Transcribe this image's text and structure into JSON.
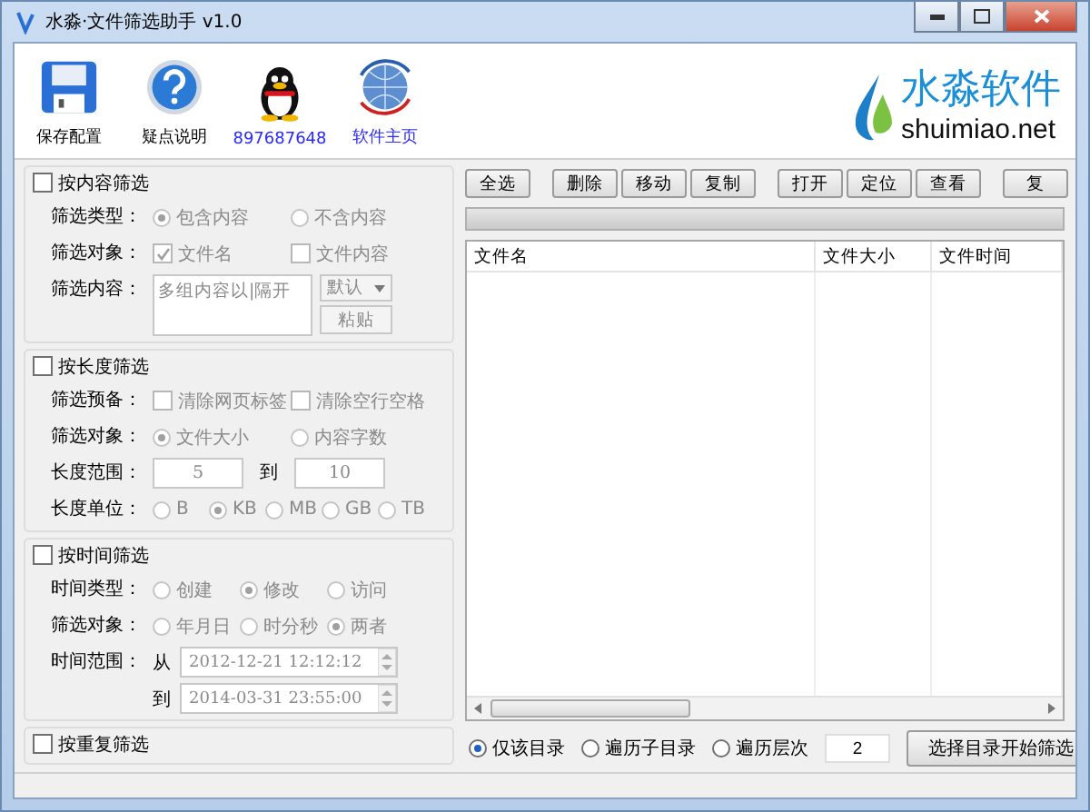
{
  "window": {
    "title": "水淼·文件筛选助手 v1.0"
  },
  "toolbar": [
    {
      "label": "保存配置",
      "kind": "save",
      "link": false
    },
    {
      "label": "疑点说明",
      "kind": "help",
      "link": false
    },
    {
      "label": "897687648",
      "kind": "penguin",
      "link": true
    },
    {
      "label": "软件主页",
      "kind": "globe",
      "link": true
    }
  ],
  "logo": {
    "name": "水淼软件",
    "domain": "shuimiao.net"
  },
  "sections": [
    {
      "title": "按内容筛选",
      "checked": false,
      "rows": [
        {
          "label": "筛选类型：",
          "kind": "radio",
          "options": [
            {
              "label": "包含内容",
              "selected": true
            },
            {
              "label": "不含内容",
              "selected": false
            }
          ]
        },
        {
          "label": "筛选对象：",
          "kind": "checkbox",
          "options": [
            {
              "label": "文件名",
              "checked": true
            },
            {
              "label": "文件内容",
              "checked": false
            }
          ]
        },
        {
          "label": "筛选内容：",
          "kind": "textarea",
          "placeholder": "多组内容以|隔开",
          "dropdown": "默认",
          "button": "粘贴"
        }
      ]
    },
    {
      "title": "按长度筛选",
      "checked": false,
      "rows": [
        {
          "label": "筛选预备：",
          "kind": "checkbox",
          "options": [
            {
              "label": "清除网页标签",
              "checked": false
            },
            {
              "label": "清除空行空格",
              "checked": false
            }
          ]
        },
        {
          "label": "筛选对象：",
          "kind": "radio",
          "options": [
            {
              "label": "文件大小",
              "selected": true
            },
            {
              "label": "内容字数",
              "selected": false
            }
          ]
        },
        {
          "label": "长度范围：",
          "kind": "range",
          "from": "5",
          "separator": "到",
          "to": "10"
        },
        {
          "label": "长度单位：",
          "kind": "radio",
          "options": [
            {
              "label": "B",
              "selected": false
            },
            {
              "label": "KB",
              "selected": true
            },
            {
              "label": "MB",
              "selected": false
            },
            {
              "label": "GB",
              "selected": false
            },
            {
              "label": "TB",
              "selected": false
            }
          ]
        }
      ]
    },
    {
      "title": "按时间筛选",
      "checked": false,
      "rows": [
        {
          "label": "时间类型：",
          "kind": "radio",
          "options": [
            {
              "label": "创建",
              "selected": false
            },
            {
              "label": "修改",
              "selected": true
            },
            {
              "label": "访问",
              "selected": false
            }
          ]
        },
        {
          "label": "筛选对象：",
          "kind": "radio",
          "options": [
            {
              "label": "年月日",
              "selected": false
            },
            {
              "label": "时分秒",
              "selected": false
            },
            {
              "label": "两者",
              "selected": true
            }
          ]
        },
        {
          "label": "时间范围：",
          "kind": "datetime",
          "entries": [
            {
              "prefix": "从",
              "value": "2012-12-21 12:12:12"
            },
            {
              "prefix": "到",
              "value": "2014-03-31 23:55:00"
            }
          ]
        }
      ]
    },
    {
      "title": "按重复筛选",
      "checked": false
    }
  ],
  "actions": [
    [
      "全选"
    ],
    [
      "删除",
      "移动",
      "复制"
    ],
    [
      "打开",
      "定位",
      "查看"
    ],
    [
      "复"
    ]
  ],
  "progress": {
    "level": 0
  },
  "table": {
    "columns": [
      "文件名",
      "文件大小",
      "文件时间"
    ]
  },
  "scope": {
    "options": [
      {
        "label": "仅该目录",
        "selected": true
      },
      {
        "label": "遍历子目录",
        "selected": false
      },
      {
        "label": "遍历层次",
        "selected": false
      }
    ],
    "depth": "2",
    "button": "选择目录开始筛选"
  }
}
